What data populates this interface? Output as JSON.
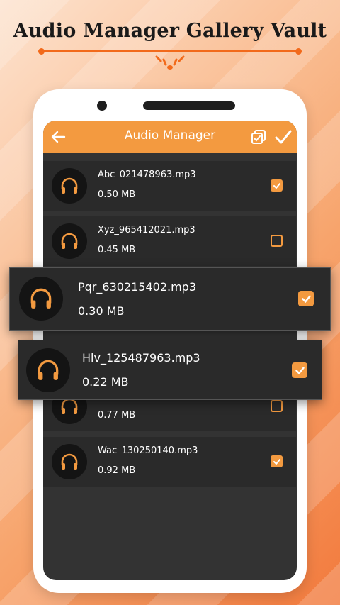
{
  "promo": {
    "title": "Audio Manager Gallery Vault"
  },
  "app_bar": {
    "title": "Audio Manager",
    "back_icon": "arrow-left-icon",
    "select_all_icon": "select-all-icon",
    "done_icon": "check-icon"
  },
  "colors": {
    "accent": "#f39a40",
    "list_bg": "#333333",
    "row_bg": "#2a2a2a"
  },
  "files": [
    {
      "name": "Abc_021478963.mp3",
      "size": "0.50 MB",
      "checked": true,
      "icon": "headphones-icon"
    },
    {
      "name": "Xyz_965412021.mp3",
      "size": "0.45 MB",
      "checked": false,
      "icon": "headphones-icon"
    },
    {
      "name": "Pqr_630215402.mp3",
      "size": "0.30 MB",
      "checked": true,
      "icon": "headphones-icon"
    },
    {
      "name": "Hlv_125487963.mp3",
      "size": "0.22 MB",
      "checked": true,
      "icon": "headphones-icon"
    },
    {
      "name": "",
      "size": "0.77 MB",
      "checked": false,
      "icon": "headphones-icon"
    },
    {
      "name": "Wac_130250140.mp3",
      "size": "0.92 MB",
      "checked": true,
      "icon": "headphones-icon"
    }
  ]
}
